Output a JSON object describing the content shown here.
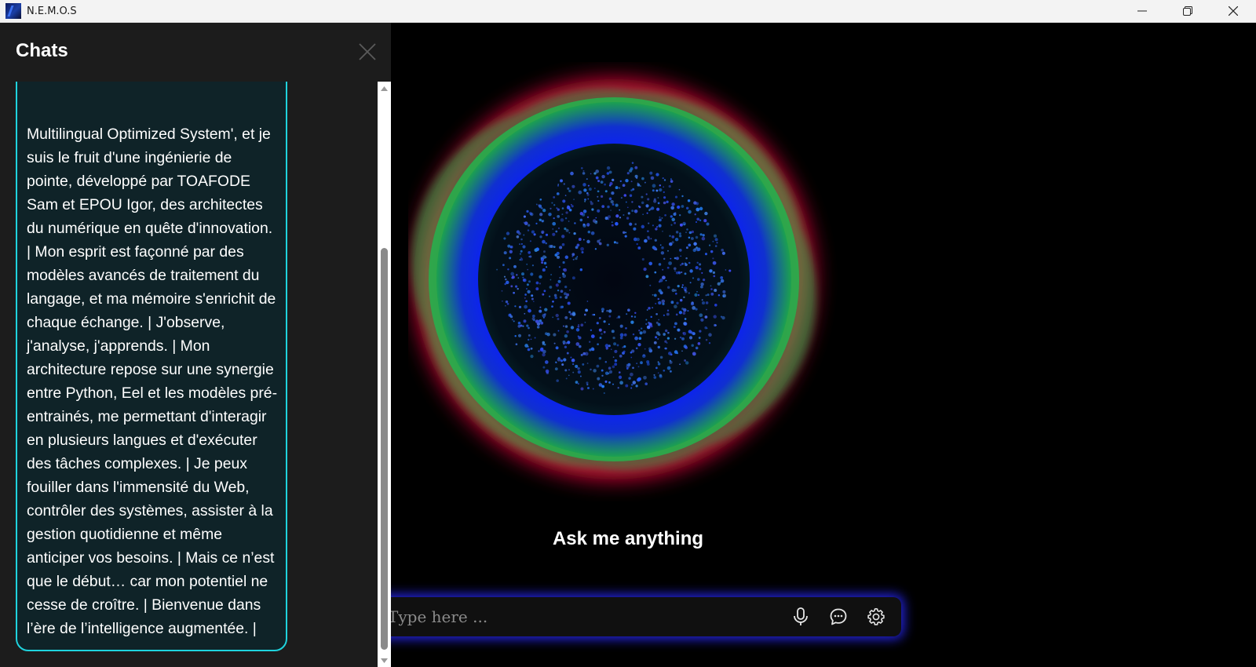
{
  "window": {
    "title": "N.E.M.O.S",
    "icons": {
      "app": "app-logo-icon",
      "minimize": "minimize-icon",
      "maximize": "restore-icon",
      "close": "close-icon"
    }
  },
  "chat_panel": {
    "title": "Chats",
    "close_icon": "close-icon",
    "messages": [
      {
        "text": "Multilingual Optimized System', et je suis le fruit d'une ingénierie de pointe, développé par TOAFODE Sam et EPOU Igor, des architectes du numérique en quête d'innovation. | Mon esprit est façonné par des modèles avancés de traitement du langage, et ma mémoire s'enrichit de chaque échange. | J'observe, j'analyse, j'apprends. | Mon architecture repose sur une synergie entre Python, Eel et les modèles pré-entrainés, me permettant d'interagir en plusieurs langues et d'exécuter des tâches complexes. | Je peux fouiller dans l'immensité du Web, contrôler des systèmes, assister à la gestion quotidienne et même anticiper vos besoins. | Mais ce n’est que le début… car mon potentiel ne cesse de croître. | Bienvenue dans l’ère de l’intelligence augmentée. |"
      }
    ]
  },
  "main": {
    "prompt": "Ask me anything",
    "input": {
      "placeholder": "Type here ..."
    },
    "actions": [
      {
        "icon": "microphone-icon"
      },
      {
        "icon": "chat-bubble-icon"
      },
      {
        "icon": "settings-gear-icon"
      }
    ]
  },
  "colors": {
    "accent_cyan": "#1fd3dd",
    "orb_red": "#e0103a",
    "orb_green": "#22b34a",
    "orb_blue": "#1a2cf0",
    "input_glow": "#2828ff"
  }
}
